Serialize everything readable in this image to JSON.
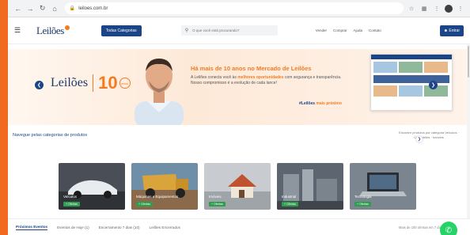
{
  "browser": {
    "url": "leiloes.com.br",
    "back_icon": "arrow-left-icon",
    "forward_icon": "arrow-right-icon",
    "reload_icon": "reload-icon",
    "home_icon": "home-icon"
  },
  "header": {
    "logo_text": "Leilões",
    "categories_button": "Todas Categorias",
    "search_placeholder": "O que você está procurando?",
    "links": [
      "Vender",
      "Comprar",
      "Ajuda",
      "Contato"
    ],
    "login_button": "Entrar"
  },
  "hero": {
    "logo_text": "Leilões",
    "anniversary_number": "10",
    "badge_text": "anos",
    "title": "Há mais de 10 anos no Mercado de Leilões",
    "subtitle_pre": "A Leilões conecta você às ",
    "subtitle_highlight": "melhores oportunidades",
    "subtitle_post": " com segurança e transparência. Nosso compromisso é a evolução de cada lance!",
    "tagline_pre": "#Leilões ",
    "tagline_highlight": "mais próximo"
  },
  "categories": {
    "heading": "Navegue pelas categorias de produtos",
    "hint": "Encontre produtos por categoria Veículos · Caminhões · Imóveis",
    "items": [
      {
        "label": "Veículos",
        "count": "+ Ofertas"
      },
      {
        "label": "Máquinas e Equipamentos",
        "count": "+ Ofertas"
      },
      {
        "label": "Imóveis",
        "count": "+ Ofertas"
      },
      {
        "label": "Industrial",
        "count": "+ Ofertas"
      },
      {
        "label": "Tecnologia",
        "count": "+ Ofertas"
      }
    ]
  },
  "tabs": {
    "items": [
      "Próximos Eventos",
      "Eventos de Hoje (1)",
      "Encerramento 7 dias (10)",
      "Leilões Encerrados"
    ],
    "right_text": "Mais de 100 ofertas em 7 dias"
  },
  "colors": {
    "brand_blue": "#1c4587",
    "brand_orange": "#f47b20",
    "whatsapp": "#25d366"
  }
}
